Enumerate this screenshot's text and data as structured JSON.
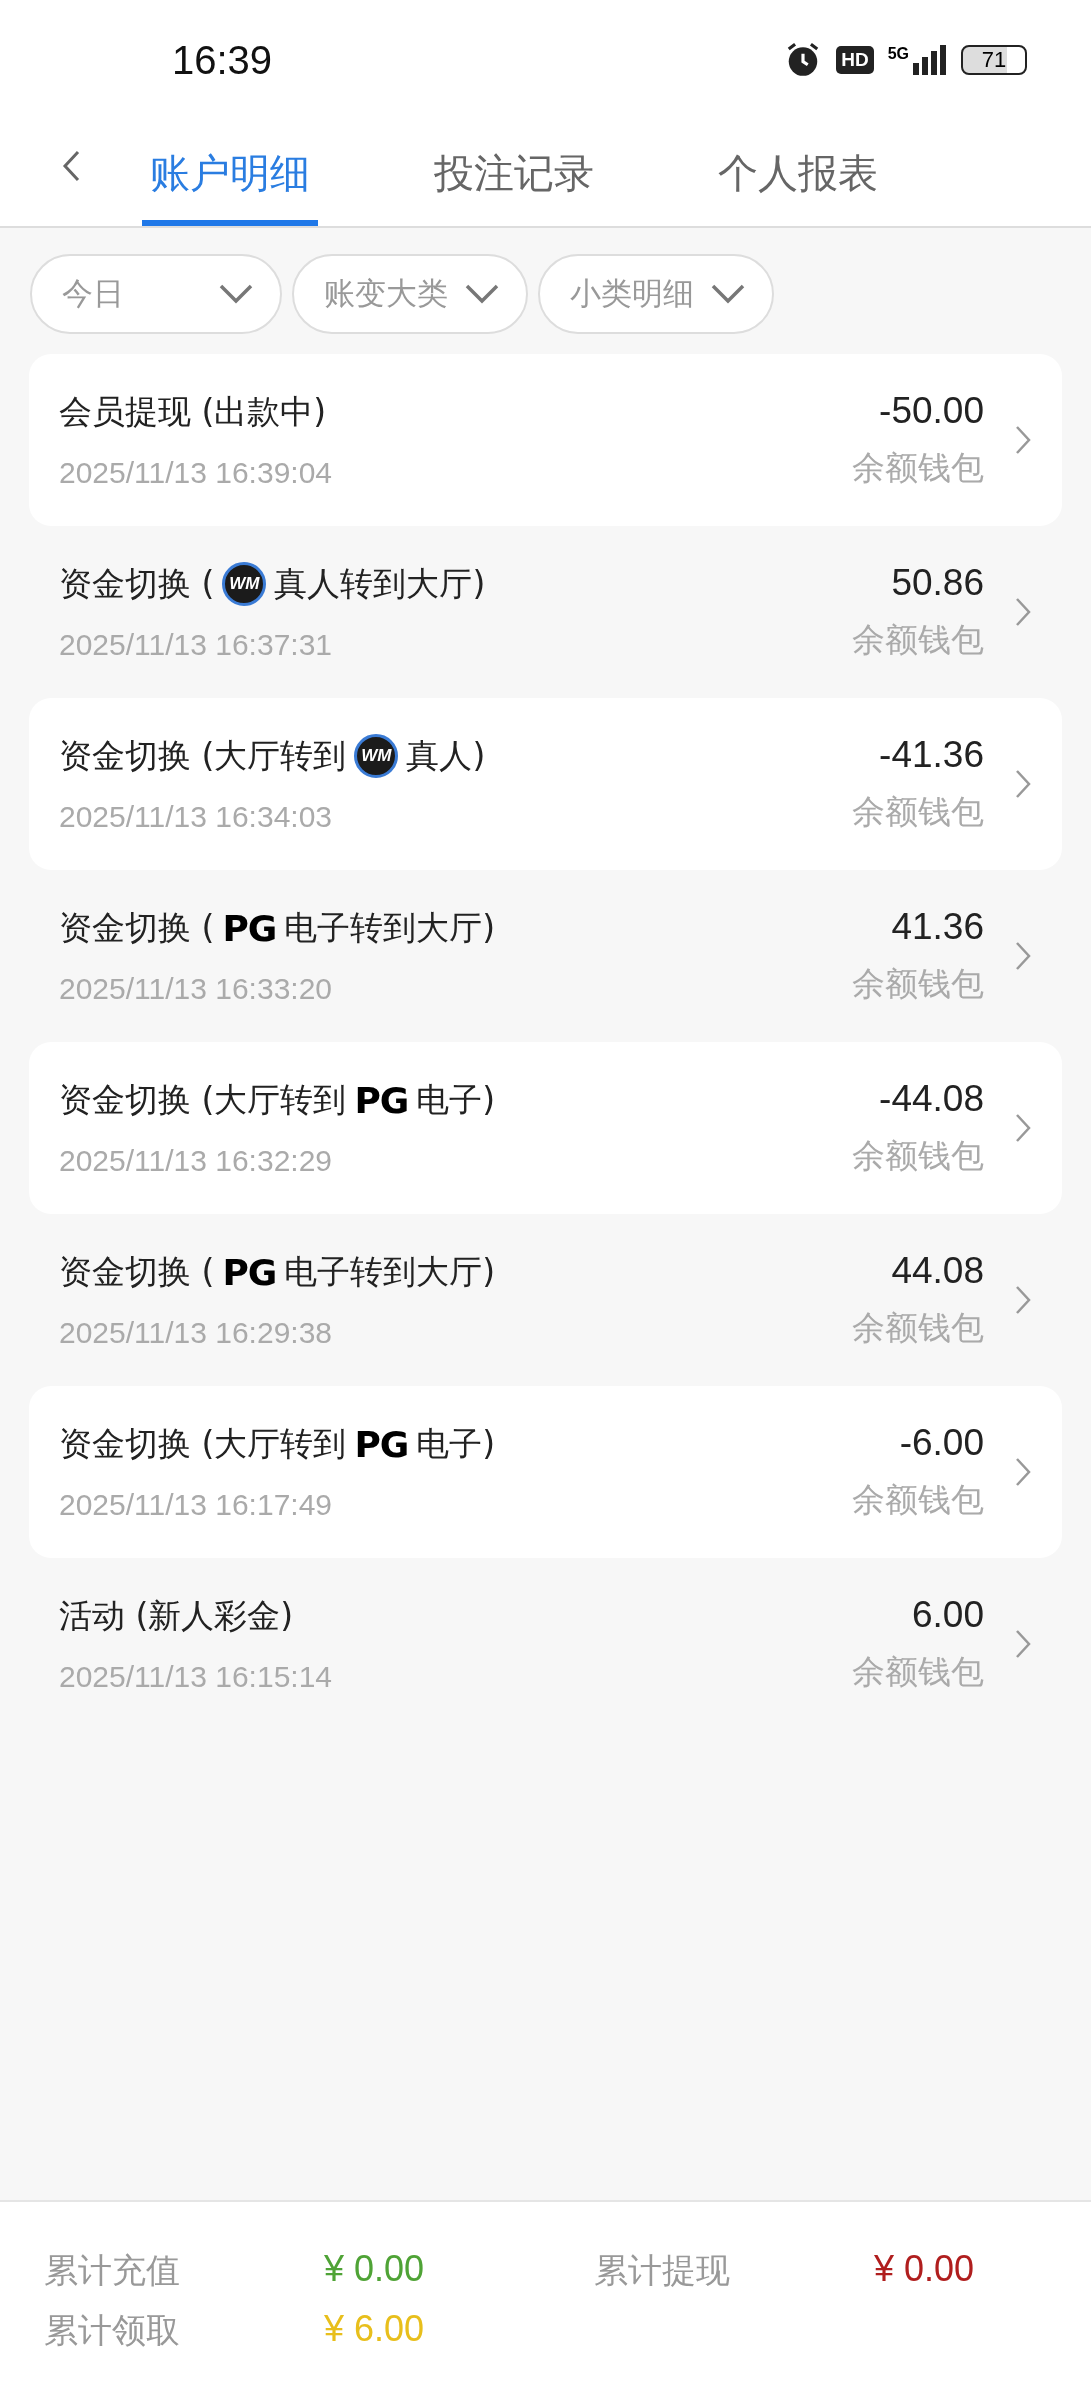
{
  "status_bar": {
    "time": "16:39",
    "hd": "HD",
    "network": "5G",
    "battery": "71"
  },
  "tabs": [
    {
      "label": "账户明细",
      "selected": true
    },
    {
      "label": "投注记录",
      "selected": false
    },
    {
      "label": "个人报表",
      "selected": false
    }
  ],
  "filters": [
    {
      "label": "今日"
    },
    {
      "label": "账变大类"
    },
    {
      "label": "小类明细"
    }
  ],
  "records": [
    {
      "title": [
        {
          "kind": "text",
          "text": "会员提现 (出款中)"
        }
      ],
      "time": "2025/11/13 16:39:04",
      "amount": "-50.00",
      "wallet": "余额钱包"
    },
    {
      "title": [
        {
          "kind": "text",
          "text": "资金切换 ("
        },
        {
          "kind": "wm-logo",
          "text": "WM"
        },
        {
          "kind": "text",
          "text": "真人转到大厅)"
        }
      ],
      "time": "2025/11/13 16:37:31",
      "amount": "50.86",
      "wallet": "余额钱包"
    },
    {
      "title": [
        {
          "kind": "text",
          "text": "资金切换 (大厅转到"
        },
        {
          "kind": "wm-logo",
          "text": "WM"
        },
        {
          "kind": "text",
          "text": "真人)"
        }
      ],
      "time": "2025/11/13 16:34:03",
      "amount": "-41.36",
      "wallet": "余额钱包"
    },
    {
      "title": [
        {
          "kind": "text",
          "text": "资金切换 ("
        },
        {
          "kind": "pg-logo",
          "text": "PG"
        },
        {
          "kind": "text",
          "text": "电子转到大厅)"
        }
      ],
      "time": "2025/11/13 16:33:20",
      "amount": "41.36",
      "wallet": "余额钱包"
    },
    {
      "title": [
        {
          "kind": "text",
          "text": "资金切换 (大厅转到"
        },
        {
          "kind": "pg-logo",
          "text": "PG"
        },
        {
          "kind": "text",
          "text": "电子)"
        }
      ],
      "time": "2025/11/13 16:32:29",
      "amount": "-44.08",
      "wallet": "余额钱包"
    },
    {
      "title": [
        {
          "kind": "text",
          "text": "资金切换 ("
        },
        {
          "kind": "pg-logo",
          "text": "PG"
        },
        {
          "kind": "text",
          "text": "电子转到大厅)"
        }
      ],
      "time": "2025/11/13 16:29:38",
      "amount": "44.08",
      "wallet": "余额钱包"
    },
    {
      "title": [
        {
          "kind": "text",
          "text": "资金切换 (大厅转到"
        },
        {
          "kind": "pg-logo",
          "text": "PG"
        },
        {
          "kind": "text",
          "text": "电子)"
        }
      ],
      "time": "2025/11/13 16:17:49",
      "amount": "-6.00",
      "wallet": "余额钱包"
    },
    {
      "title": [
        {
          "kind": "text",
          "text": "活动 (新人彩金)"
        }
      ],
      "time": "2025/11/13 16:15:14",
      "amount": "6.00",
      "wallet": "余额钱包"
    }
  ],
  "summary": [
    {
      "label": "累计充值",
      "value": "¥ 0.00",
      "color": "#4fa336"
    },
    {
      "label": "累计提现",
      "value": "¥ 0.00",
      "color": "#b01e1e"
    },
    {
      "label": "累计领取",
      "value": "¥ 6.00",
      "color": "#e8bf1c"
    }
  ]
}
